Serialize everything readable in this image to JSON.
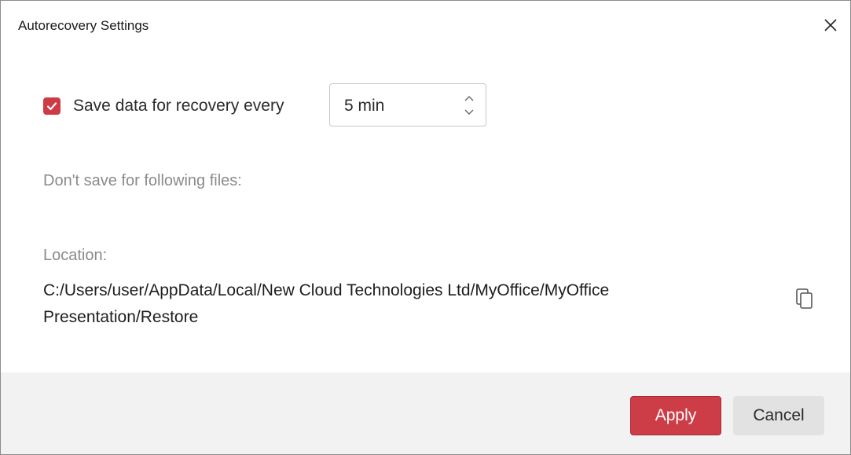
{
  "dialog": {
    "title": "Autorecovery Settings",
    "close_icon": "close-icon"
  },
  "autosave": {
    "checked": true,
    "label": "Save data for recovery every",
    "interval_value": "5 min"
  },
  "exclusions": {
    "label": "Don't save for following files:"
  },
  "location": {
    "label": "Location:",
    "path": "C:/Users/user/AppData/Local/New Cloud Technologies Ltd/MyOffice/MyOffice Presentation/Restore",
    "copy_icon": "copy-icon"
  },
  "footer": {
    "apply_label": "Apply",
    "cancel_label": "Cancel"
  },
  "colors": {
    "accent": "#cd3d48",
    "footer_bg": "#f2f2f2",
    "muted_text": "#8a8a8a"
  }
}
